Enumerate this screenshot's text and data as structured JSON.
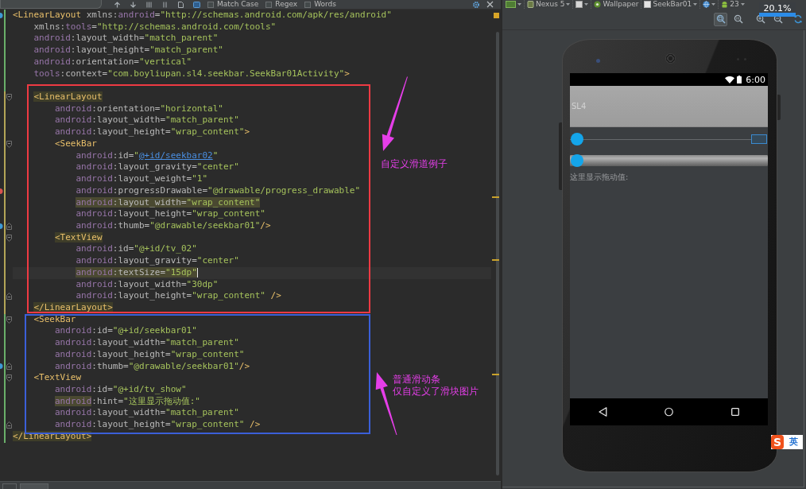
{
  "find_bar": {
    "options": [
      {
        "label": "Match Case",
        "checked": false
      },
      {
        "label": "Regex",
        "checked": false
      },
      {
        "label": "Words",
        "checked": false
      }
    ]
  },
  "editor": {
    "lines": [
      {
        "current": false,
        "modified": false,
        "gutter_icon": {
          "kind": "info"
        },
        "tokens": [
          {
            "text": "<LinearLayout",
            "kind": "tag",
            "highlighted": false
          },
          {
            "text": " xmlns:",
            "kind": "attr",
            "highlighted": false
          },
          {
            "text": "android",
            "kind": "ns",
            "highlighted": false
          },
          {
            "text": "=",
            "kind": "attr",
            "highlighted": false
          },
          {
            "text": "\"http://schemas.android.com/apk/res/android\"",
            "kind": "value",
            "highlighted": false
          }
        ],
        "children": [
          {
            "current": false,
            "modified": false,
            "tokens": [
              {
                "text": "xmlns:",
                "kind": "attr",
                "highlighted": false
              },
              {
                "text": "tools",
                "kind": "ns",
                "highlighted": false
              },
              {
                "text": "=",
                "kind": "attr",
                "highlighted": false
              },
              {
                "text": "\"http://schemas.android.com/tools\"",
                "kind": "value",
                "highlighted": false
              }
            ]
          },
          {
            "current": false,
            "modified": false,
            "tokens": [
              {
                "text": "android",
                "kind": "ns",
                "highlighted": false
              },
              {
                "text": ":layout_width=",
                "kind": "attr",
                "highlighted": false
              },
              {
                "text": "\"match_parent\"",
                "kind": "value",
                "highlighted": false
              }
            ]
          },
          {
            "current": false,
            "modified": false,
            "tokens": [
              {
                "text": "android",
                "kind": "ns",
                "highlighted": false
              },
              {
                "text": ":layout_height=",
                "kind": "attr",
                "highlighted": false
              },
              {
                "text": "\"match_parent\"",
                "kind": "value",
                "highlighted": false
              }
            ]
          },
          {
            "current": false,
            "modified": false,
            "tokens": [
              {
                "text": "android",
                "kind": "ns",
                "highlighted": false
              },
              {
                "text": ":orientation=",
                "kind": "attr",
                "highlighted": false
              },
              {
                "text": "\"vertical\"",
                "kind": "value",
                "highlighted": false
              }
            ]
          },
          {
            "current": false,
            "modified": false,
            "tokens": [
              {
                "text": "tools",
                "kind": "ns",
                "highlighted": false
              },
              {
                "text": ":context=",
                "kind": "attr",
                "highlighted": false
              },
              {
                "text": "\"com.boyliupan.sl4.seekbar.SeekBar01Activity\"",
                "kind": "value",
                "highlighted": false
              },
              {
                "text": ">",
                "kind": "tag",
                "highlighted": false
              }
            ]
          },
          {
            "current": false,
            "modified": false
          },
          {
            "current": false,
            "modified": true,
            "fold": {
              "kind": "start"
            },
            "tokens": [
              {
                "text": "<LinearLayout",
                "kind": "tag",
                "highlighted": true
              }
            ],
            "children": [
              {
                "current": false,
                "modified": true,
                "tokens": [
                  {
                    "text": "android",
                    "kind": "ns",
                    "highlighted": false
                  },
                  {
                    "text": ":orientation=",
                    "kind": "attr",
                    "highlighted": false
                  },
                  {
                    "text": "\"horizontal\"",
                    "kind": "value",
                    "highlighted": false
                  }
                ]
              },
              {
                "current": false,
                "modified": true,
                "tokens": [
                  {
                    "text": "android",
                    "kind": "ns",
                    "highlighted": false
                  },
                  {
                    "text": ":layout_width=",
                    "kind": "attr",
                    "highlighted": false
                  },
                  {
                    "text": "\"match_parent\"",
                    "kind": "value",
                    "highlighted": false
                  }
                ]
              },
              {
                "current": false,
                "modified": true,
                "tokens": [
                  {
                    "text": "android",
                    "kind": "ns",
                    "highlighted": false
                  },
                  {
                    "text": ":layout_height=",
                    "kind": "attr",
                    "highlighted": false
                  },
                  {
                    "text": "\"wrap_content\"",
                    "kind": "value",
                    "highlighted": false
                  },
                  {
                    "text": ">",
                    "kind": "tag",
                    "highlighted": false
                  }
                ]
              },
              {
                "current": false,
                "modified": true,
                "fold": {
                  "kind": "start"
                },
                "tokens": [
                  {
                    "text": "<SeekBar",
                    "kind": "tag",
                    "highlighted": false
                  }
                ],
                "children": [
                  {
                    "current": false,
                    "modified": true,
                    "tokens": [
                      {
                        "text": "android",
                        "kind": "ns",
                        "highlighted": false
                      },
                      {
                        "text": ":id=",
                        "kind": "attr",
                        "highlighted": false
                      },
                      {
                        "text": "\"",
                        "kind": "value",
                        "highlighted": false
                      },
                      {
                        "text": "@+id/seekbar02",
                        "kind": "link",
                        "highlighted": false
                      },
                      {
                        "text": "\"",
                        "kind": "value",
                        "highlighted": false
                      }
                    ]
                  },
                  {
                    "current": false,
                    "modified": true,
                    "tokens": [
                      {
                        "text": "android",
                        "kind": "ns",
                        "highlighted": false
                      },
                      {
                        "text": ":layout_gravity=",
                        "kind": "attr",
                        "highlighted": false
                      },
                      {
                        "text": "\"center\"",
                        "kind": "value",
                        "highlighted": false
                      }
                    ]
                  },
                  {
                    "current": false,
                    "modified": true,
                    "tokens": [
                      {
                        "text": "android",
                        "kind": "ns",
                        "highlighted": false
                      },
                      {
                        "text": ":layout_weight=",
                        "kind": "attr",
                        "highlighted": false
                      },
                      {
                        "text": "\"1\"",
                        "kind": "value",
                        "highlighted": false
                      }
                    ]
                  },
                  {
                    "current": false,
                    "modified": true,
                    "gutter_icon": {
                      "kind": "error"
                    },
                    "tokens": [
                      {
                        "text": "android",
                        "kind": "ns",
                        "highlighted": false
                      },
                      {
                        "text": ":progressDrawable=",
                        "kind": "attr",
                        "highlighted": false
                      },
                      {
                        "text": "\"@drawable/progress_drawable\"",
                        "kind": "value",
                        "highlighted": false
                      }
                    ]
                  },
                  {
                    "current": false,
                    "modified": true,
                    "tokens": [
                      {
                        "text": "android",
                        "kind": "ns",
                        "highlighted": true
                      },
                      {
                        "text": ":layout_width=",
                        "kind": "attr",
                        "highlighted": true
                      },
                      {
                        "text": "\"wrap_content\"",
                        "kind": "value",
                        "highlighted": true
                      }
                    ]
                  },
                  {
                    "current": false,
                    "modified": true,
                    "tokens": [
                      {
                        "text": "android",
                        "kind": "ns",
                        "highlighted": false
                      },
                      {
                        "text": ":layout_height=",
                        "kind": "attr",
                        "highlighted": false
                      },
                      {
                        "text": "\"wrap_content\"",
                        "kind": "value",
                        "highlighted": false
                      }
                    ]
                  },
                  {
                    "current": false,
                    "modified": true,
                    "gutter_icon": {
                      "kind": "info"
                    },
                    "fold": {
                      "kind": "end"
                    },
                    "tokens": [
                      {
                        "text": "android",
                        "kind": "ns",
                        "highlighted": false
                      },
                      {
                        "text": ":thumb=",
                        "kind": "attr",
                        "highlighted": false
                      },
                      {
                        "text": "\"@drawable/seekbar01\"",
                        "kind": "value",
                        "highlighted": false
                      },
                      {
                        "text": "/>",
                        "kind": "tag",
                        "highlighted": false
                      }
                    ]
                  }
                ]
              },
              {
                "current": false,
                "modified": true,
                "fold": {
                  "kind": "start"
                },
                "tokens": [
                  {
                    "text": "<TextView",
                    "kind": "tag",
                    "highlighted": true
                  }
                ],
                "children": [
                  {
                    "current": false,
                    "modified": true,
                    "tokens": [
                      {
                        "text": "android",
                        "kind": "ns",
                        "highlighted": false
                      },
                      {
                        "text": ":id=",
                        "kind": "attr",
                        "highlighted": false
                      },
                      {
                        "text": "\"@+id/tv_02\"",
                        "kind": "value",
                        "highlighted": false
                      }
                    ]
                  },
                  {
                    "current": false,
                    "modified": true,
                    "tokens": [
                      {
                        "text": "android",
                        "kind": "ns",
                        "highlighted": false
                      },
                      {
                        "text": ":layout_gravity=",
                        "kind": "attr",
                        "highlighted": false
                      },
                      {
                        "text": "\"center\"",
                        "kind": "value",
                        "highlighted": false
                      }
                    ]
                  },
                  {
                    "current": true,
                    "modified": true,
                    "tokens": [
                      {
                        "text": "android",
                        "kind": "ns",
                        "highlighted": true
                      },
                      {
                        "text": ":textSize=",
                        "kind": "attr",
                        "highlighted": true
                      },
                      {
                        "text": "\"15dp\"",
                        "kind": "value",
                        "highlighted": true
                      }
                    ]
                  },
                  {
                    "current": false,
                    "modified": true,
                    "tokens": [
                      {
                        "text": "android",
                        "kind": "ns",
                        "highlighted": false
                      },
                      {
                        "text": ":layout_width=",
                        "kind": "attr",
                        "highlighted": false
                      },
                      {
                        "text": "\"30dp\"",
                        "kind": "value",
                        "highlighted": false
                      }
                    ]
                  },
                  {
                    "current": false,
                    "modified": true,
                    "fold": {
                      "kind": "end"
                    },
                    "tokens": [
                      {
                        "text": "android",
                        "kind": "ns",
                        "highlighted": false
                      },
                      {
                        "text": ":layout_height=",
                        "kind": "attr",
                        "highlighted": false
                      },
                      {
                        "text": "\"wrap_content\"",
                        "kind": "value",
                        "highlighted": false
                      },
                      {
                        "text": " />",
                        "kind": "tag",
                        "highlighted": false
                      }
                    ]
                  }
                ]
              }
            ]
          },
          {
            "current": false,
            "modified": true,
            "tokens": [
              {
                "text": "</LinearLayout>",
                "kind": "tag",
                "highlighted": true
              }
            ]
          },
          {
            "current": false,
            "modified": false,
            "fold": {
              "kind": "start"
            },
            "tokens": [
              {
                "text": "<SeekBar",
                "kind": "tag",
                "highlighted": false
              }
            ],
            "children": [
              {
                "current": false,
                "modified": false,
                "tokens": [
                  {
                    "text": "android",
                    "kind": "ns",
                    "highlighted": false
                  },
                  {
                    "text": ":id=",
                    "kind": "attr",
                    "highlighted": false
                  },
                  {
                    "text": "\"@+id/seekbar01\"",
                    "kind": "value",
                    "highlighted": false
                  }
                ]
              },
              {
                "current": false,
                "modified": false,
                "tokens": [
                  {
                    "text": "android",
                    "kind": "ns",
                    "highlighted": false
                  },
                  {
                    "text": ":layout_width=",
                    "kind": "attr",
                    "highlighted": false
                  },
                  {
                    "text": "\"match_parent\"",
                    "kind": "value",
                    "highlighted": false
                  }
                ]
              },
              {
                "current": false,
                "modified": false,
                "tokens": [
                  {
                    "text": "android",
                    "kind": "ns",
                    "highlighted": false
                  },
                  {
                    "text": ":layout_height=",
                    "kind": "attr",
                    "highlighted": false
                  },
                  {
                    "text": "\"wrap_content\"",
                    "kind": "value",
                    "highlighted": false
                  }
                ]
              },
              {
                "current": false,
                "modified": false,
                "gutter_icon": {
                  "kind": "info"
                },
                "fold": {
                  "kind": "end"
                },
                "tokens": [
                  {
                    "text": "android",
                    "kind": "ns",
                    "highlighted": false
                  },
                  {
                    "text": ":thumb=",
                    "kind": "attr",
                    "highlighted": false
                  },
                  {
                    "text": "\"@drawable/seekbar01\"",
                    "kind": "value",
                    "highlighted": false
                  },
                  {
                    "text": "/>",
                    "kind": "tag",
                    "highlighted": false
                  }
                ]
              }
            ]
          },
          {
            "current": false,
            "modified": false,
            "fold": {
              "kind": "start"
            },
            "tokens": [
              {
                "text": "<TextView",
                "kind": "tag",
                "highlighted": false
              }
            ],
            "children": [
              {
                "current": false,
                "modified": false,
                "tokens": [
                  {
                    "text": "android",
                    "kind": "ns",
                    "highlighted": false
                  },
                  {
                    "text": ":id=",
                    "kind": "attr",
                    "highlighted": false
                  },
                  {
                    "text": "\"@+id/tv_show\"",
                    "kind": "value",
                    "highlighted": false
                  }
                ]
              },
              {
                "current": false,
                "modified": false,
                "tokens": [
                  {
                    "text": "android",
                    "kind": "ns",
                    "highlighted": true
                  },
                  {
                    "text": ":hint=",
                    "kind": "attr",
                    "highlighted": false
                  },
                  {
                    "text": "\"这里显示拖动值:\"",
                    "kind": "value",
                    "highlighted": false
                  }
                ]
              },
              {
                "current": false,
                "modified": false,
                "tokens": [
                  {
                    "text": "android",
                    "kind": "ns",
                    "highlighted": false
                  },
                  {
                    "text": ":layout_width=",
                    "kind": "attr",
                    "highlighted": false
                  },
                  {
                    "text": "\"match_parent\"",
                    "kind": "value",
                    "highlighted": false
                  }
                ]
              },
              {
                "current": false,
                "modified": false,
                "fold": {
                  "kind": "end"
                },
                "tokens": [
                  {
                    "text": "android",
                    "kind": "ns",
                    "highlighted": false
                  },
                  {
                    "text": ":layout_height=",
                    "kind": "attr",
                    "highlighted": false
                  },
                  {
                    "text": "\"wrap_content\"",
                    "kind": "value",
                    "highlighted": false
                  },
                  {
                    "text": " />",
                    "kind": "tag",
                    "highlighted": false
                  }
                ]
              }
            ]
          }
        ]
      },
      {
        "current": false,
        "modified": false,
        "tokens": [
          {
            "text": "</LinearLayout>",
            "kind": "tag",
            "highlighted": true
          }
        ]
      }
    ]
  },
  "annotations": {
    "boxes": [
      {
        "color": "#ee3a43"
      },
      {
        "color": "#3b5fd8"
      }
    ],
    "notes": [
      {
        "lines": [
          "自定义滑道例子"
        ]
      },
      {
        "lines": [
          "普通滑动条",
          "仅自定义了滑块图片"
        ]
      }
    ]
  },
  "designer": {
    "toolbar": [
      {
        "kind": "layout",
        "dropdown": true
      },
      {
        "kind": "device",
        "label": "Nexus 5",
        "dropdown": true
      },
      {
        "kind": "orientation",
        "dropdown": true
      },
      {
        "kind": "theme",
        "label": "Wallpaper",
        "dropdown": false
      },
      {
        "kind": "activity",
        "label": "SeekBar01",
        "dropdown": true
      },
      {
        "kind": "locale",
        "dropdown": true
      },
      {
        "kind": "api",
        "label": "23",
        "dropdown": true
      }
    ],
    "zoom_tools": [
      {
        "kind": "fit",
        "selected": true
      },
      {
        "kind": "actual",
        "selected": false
      },
      {
        "kind": "in",
        "selected": false
      },
      {
        "kind": "out",
        "selected": false
      }
    ],
    "zoom_level": "20.1%"
  },
  "phone": {
    "status_time": "6:00",
    "app_title": "SL4",
    "rows": [
      {
        "seekbar": {
          "kind": "line",
          "level": 0
        },
        "text_view": {
          "selected": true
        }
      },
      {
        "seekbar": {
          "kind": "bar",
          "level": 0
        }
      }
    ],
    "hint": "这里显示拖动值:"
  },
  "ime": {
    "logo": "S",
    "mode": "英"
  }
}
